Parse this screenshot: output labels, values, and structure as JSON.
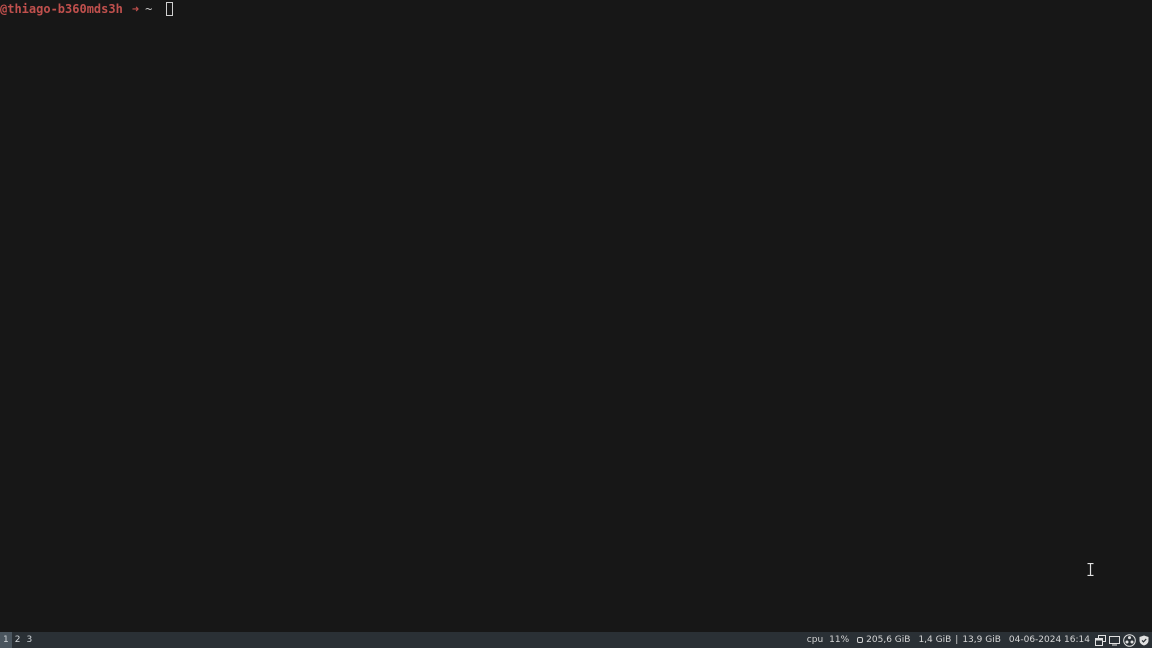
{
  "terminal": {
    "host": "@thiago-b360mds3h",
    "arrow": "➜",
    "dir": "~"
  },
  "statusbar": {
    "workspaces": [
      "1",
      "2",
      "3"
    ],
    "active_workspace": "1",
    "cpu_label": "cpu",
    "cpu_value": "11%",
    "disk_value": "205,6 GiB",
    "mem_used": "1,4 GiB",
    "mem_separator": "|",
    "mem_total": "13,9 GiB",
    "datetime": "04-06-2024 16:14"
  },
  "tray_icons": [
    "windows-icon",
    "display-icon",
    "obs-icon",
    "shield-icon"
  ],
  "colors": {
    "background": "#171717",
    "prompt": "#c0504d",
    "statusbar": "#2a3035"
  }
}
